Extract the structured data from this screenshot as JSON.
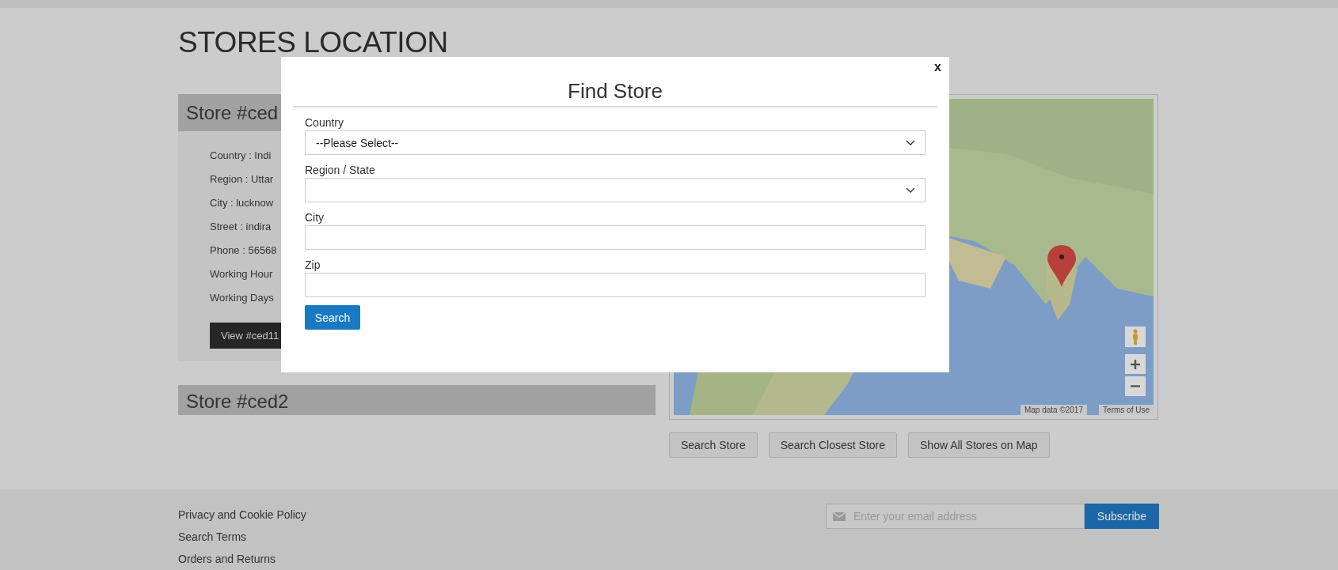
{
  "page": {
    "title": "STORES LOCATION"
  },
  "stores": [
    {
      "header": "Store #ced",
      "details": [
        "Country : Indi",
        "Region : Uttar",
        "City : lucknow",
        "Street : indira",
        "Phone : 56568",
        "Working Hour",
        "Working Days"
      ],
      "button": "View #ced11"
    },
    {
      "header": "Store #ced2"
    }
  ],
  "map": {
    "kind": "picture",
    "attribution": "Map data ©2017",
    "terms": "Terms of Use"
  },
  "map_buttons": [
    "Search Store",
    "Search Closest Store",
    "Show All Stores on Map"
  ],
  "footer": {
    "links": [
      "Privacy and Cookie Policy",
      "Search Terms",
      "Orders and Returns"
    ],
    "newsletter": {
      "placeholder": "Enter your email address",
      "button": "Subscribe"
    }
  },
  "modal": {
    "close": "x",
    "title": "Find Store",
    "button": "Search",
    "fields": [
      {
        "kind": "select",
        "label": "Country",
        "value": "--Please Select--"
      },
      {
        "kind": "select",
        "label": "Region / State"
      },
      {
        "kind": "input",
        "label": "City"
      },
      {
        "kind": "input",
        "label": "Zip"
      }
    ]
  }
}
